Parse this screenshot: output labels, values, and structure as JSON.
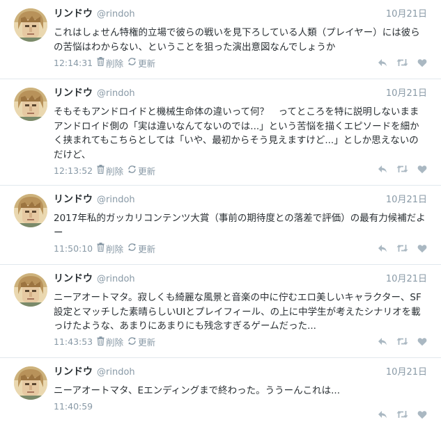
{
  "author": {
    "name": "リンドウ",
    "handle": "@rindoh"
  },
  "labels": {
    "delete": "削除",
    "refresh": "更新"
  },
  "tweets": [
    {
      "date": "10月21日",
      "text": "これはしょせん特権的立場で彼らの戦いを見下ろしている人類（プレイヤー）には彼らの苦悩はわからない、ということを狙った演出意図なんでしょうか",
      "time": "12:14:31"
    },
    {
      "date": "10月21日",
      "text": "そもそもアンドロイドと機械生命体の違いって何？　ってところを特に説明しないままアンドロイド側の「実は違いなんてないのでは...」という苦悩を描くエピソードを細かく挟まれてもこちらとしては「いや、最初からそう見えますけど...」としか思えないのだけど、",
      "time": "12:13:52"
    },
    {
      "date": "10月21日",
      "text": "2017年私的ガッカリコンテンツ大賞（事前の期待度との落差で評価）の最有力候補だよー",
      "time": "11:50:10"
    },
    {
      "date": "10月21日",
      "text": "ニーアオートマタ。寂しくも綺麗な風景と音楽の中に佇むエロ美しいキャラクター、SF設定とマッチした素晴らしいUIとプレイフィール、の上に中学生が考えたシナリオを載っけたような、あまりにあまりにも残念すぎるゲームだった...",
      "time": "11:43:53"
    },
    {
      "date": "10月21日",
      "text": "ニーアオートマタ、Eエンディングまで終わった。ううーんこれは...",
      "time": "11:40:59"
    }
  ],
  "icons": {
    "avatar": "pixel-art-portrait",
    "delete": "trash-icon",
    "refresh": "refresh-icon",
    "reply": "reply-icon",
    "retweet": "retweet-icon",
    "like": "heart-icon"
  },
  "colors": {
    "text": "#292f33",
    "muted": "#8899a6",
    "icon": "#aab8c2",
    "divider": "#e1e8ed"
  }
}
